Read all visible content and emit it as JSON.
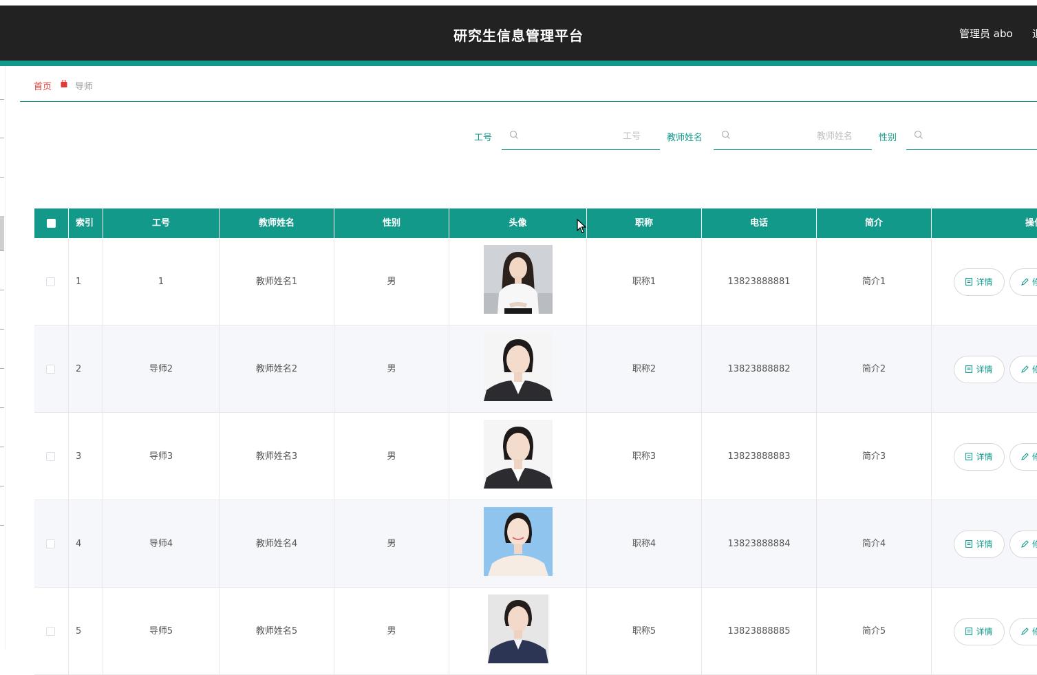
{
  "header": {
    "title": "研究生信息管理平台",
    "user": "管理员 abo",
    "logout": "退"
  },
  "breadcrumb": {
    "home": "首页",
    "current": "导师"
  },
  "search": {
    "fields": [
      {
        "label": "工号",
        "placeholder": "工号"
      },
      {
        "label": "教师姓名",
        "placeholder": "教师姓名"
      },
      {
        "label": "性别",
        "placeholder": "性别"
      }
    ]
  },
  "table": {
    "columns": [
      "索引",
      "工号",
      "教师姓名",
      "性别",
      "头像",
      "职称",
      "电话",
      "简介",
      "操作"
    ],
    "rows": [
      {
        "index": "1",
        "no": "1",
        "name": "教师姓名1",
        "gender": "男",
        "title": "职称1",
        "phone": "13823888881",
        "intro": "简介1",
        "avatar": "portrait-white-shirt"
      },
      {
        "index": "2",
        "no": "导师2",
        "name": "教师姓名2",
        "gender": "男",
        "title": "职称2",
        "phone": "13823888882",
        "intro": "简介2",
        "avatar": "portrait-dark-suit"
      },
      {
        "index": "3",
        "no": "导师3",
        "name": "教师姓名3",
        "gender": "男",
        "title": "职称3",
        "phone": "13823888883",
        "intro": "简介3",
        "avatar": "portrait-dark-suit"
      },
      {
        "index": "4",
        "no": "导师4",
        "name": "教师姓名4",
        "gender": "男",
        "title": "职称4",
        "phone": "13823888884",
        "intro": "简介4",
        "avatar": "portrait-blue-bg"
      },
      {
        "index": "5",
        "no": "导师5",
        "name": "教师姓名5",
        "gender": "男",
        "title": "职称5",
        "phone": "13823888885",
        "intro": "简介5",
        "avatar": "portrait-navy-suit"
      }
    ],
    "actions": {
      "detail": "详情",
      "edit": "修"
    }
  },
  "colors": {
    "accent": "#12998a",
    "header": "#222222",
    "home_link": "#e53935"
  },
  "icons": {
    "search": "search-icon",
    "detail": "document-icon",
    "edit": "pencil-icon",
    "breadcrumb_sep": "bag-icon"
  }
}
